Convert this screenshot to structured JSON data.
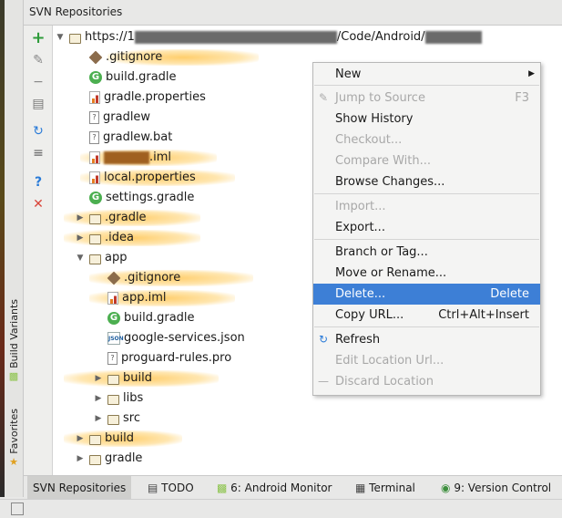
{
  "panel_title": "SVN Repositories",
  "left_strip": {
    "build_variants": "Build Variants",
    "favorites": "Favorites"
  },
  "tree": {
    "root_prefix": "https://1",
    "root_middle": "/Code/Android/",
    "items": [
      {
        "label": ".gitignore",
        "icon": "git-icon"
      },
      {
        "label": "build.gradle",
        "icon": "gradle-icon"
      },
      {
        "label": "gradle.properties",
        "icon": "properties-icon"
      },
      {
        "label": "gradlew",
        "icon": "file-icon"
      },
      {
        "label": "gradlew.bat",
        "icon": "file-icon"
      },
      {
        "label": ".iml",
        "icon": "iml-icon"
      },
      {
        "label": "local.properties",
        "icon": "properties-icon"
      },
      {
        "label": "settings.gradle",
        "icon": "gradle-icon"
      },
      {
        "label": ".gradle",
        "icon": "folder-icon"
      },
      {
        "label": ".idea",
        "icon": "folder-icon"
      },
      {
        "label": "app",
        "icon": "folder-icon"
      },
      {
        "label": ".gitignore",
        "icon": "git-icon"
      },
      {
        "label": "app.iml",
        "icon": "iml-icon"
      },
      {
        "label": "build.gradle",
        "icon": "gradle-icon"
      },
      {
        "label": "google-services.json",
        "icon": "json-icon"
      },
      {
        "label": "proguard-rules.pro",
        "icon": "file-icon"
      },
      {
        "label": "build",
        "icon": "folder-icon"
      },
      {
        "label": "libs",
        "icon": "folder-icon"
      },
      {
        "label": "src",
        "icon": "folder-icon"
      },
      {
        "label": "build",
        "icon": "folder-icon"
      },
      {
        "label": "gradle",
        "icon": "folder-icon"
      }
    ]
  },
  "context_menu": {
    "items": [
      {
        "label": "New",
        "shortcut": "",
        "disabled": false
      },
      {
        "label": "Jump to Source",
        "shortcut": "F3",
        "disabled": true
      },
      {
        "label": "Show History",
        "shortcut": "",
        "disabled": false
      },
      {
        "label": "Checkout...",
        "shortcut": "",
        "disabled": true
      },
      {
        "label": "Compare With...",
        "shortcut": "",
        "disabled": true
      },
      {
        "label": "Browse Changes...",
        "shortcut": "",
        "disabled": false
      },
      {
        "label": "Import...",
        "shortcut": "",
        "disabled": true
      },
      {
        "label": "Export...",
        "shortcut": "",
        "disabled": false
      },
      {
        "label": "Branch or Tag...",
        "shortcut": "",
        "disabled": false
      },
      {
        "label": "Move or Rename...",
        "shortcut": "",
        "disabled": false
      },
      {
        "label": "Delete...",
        "shortcut": "Delete",
        "disabled": false,
        "selected": true
      },
      {
        "label": "Copy URL...",
        "shortcut": "Ctrl+Alt+Insert",
        "disabled": false
      },
      {
        "label": "Refresh",
        "shortcut": "",
        "disabled": false
      },
      {
        "label": "Edit Location Url...",
        "shortcut": "",
        "disabled": true
      },
      {
        "label": "Discard Location",
        "shortcut": "",
        "disabled": true
      }
    ]
  },
  "bottom_tabs": [
    {
      "label": "SVN Repositories",
      "active": true
    },
    {
      "label": "TODO"
    },
    {
      "label": "6: Android Monitor"
    },
    {
      "label": "Terminal"
    },
    {
      "label": "9: Version Control"
    }
  ],
  "colors": {
    "selection": "#3d7fd6",
    "highlight": "#ffbe3c",
    "add_green": "#2e9b3a",
    "remove_red": "#d9453a",
    "help_blue": "#2a7bd8"
  }
}
